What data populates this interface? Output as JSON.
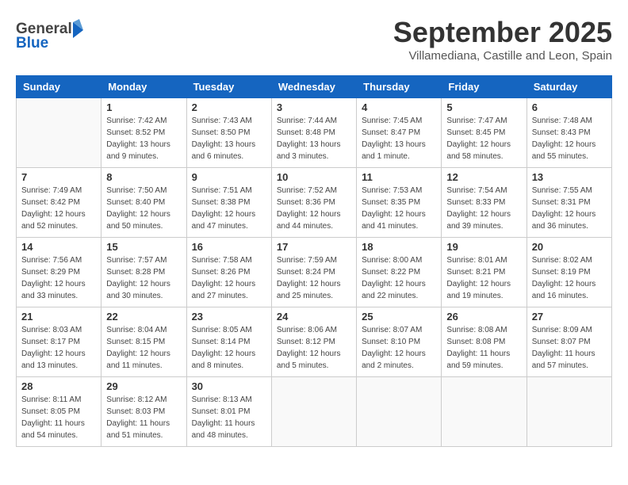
{
  "header": {
    "logo_general": "General",
    "logo_blue": "Blue",
    "month_title": "September 2025",
    "location": "Villamediana, Castille and Leon, Spain"
  },
  "weekdays": [
    "Sunday",
    "Monday",
    "Tuesday",
    "Wednesday",
    "Thursday",
    "Friday",
    "Saturday"
  ],
  "weeks": [
    [
      {
        "day": "",
        "sunrise": "",
        "sunset": "",
        "daylight": ""
      },
      {
        "day": "1",
        "sunrise": "Sunrise: 7:42 AM",
        "sunset": "Sunset: 8:52 PM",
        "daylight": "Daylight: 13 hours and 9 minutes."
      },
      {
        "day": "2",
        "sunrise": "Sunrise: 7:43 AM",
        "sunset": "Sunset: 8:50 PM",
        "daylight": "Daylight: 13 hours and 6 minutes."
      },
      {
        "day": "3",
        "sunrise": "Sunrise: 7:44 AM",
        "sunset": "Sunset: 8:48 PM",
        "daylight": "Daylight: 13 hours and 3 minutes."
      },
      {
        "day": "4",
        "sunrise": "Sunrise: 7:45 AM",
        "sunset": "Sunset: 8:47 PM",
        "daylight": "Daylight: 13 hours and 1 minute."
      },
      {
        "day": "5",
        "sunrise": "Sunrise: 7:47 AM",
        "sunset": "Sunset: 8:45 PM",
        "daylight": "Daylight: 12 hours and 58 minutes."
      },
      {
        "day": "6",
        "sunrise": "Sunrise: 7:48 AM",
        "sunset": "Sunset: 8:43 PM",
        "daylight": "Daylight: 12 hours and 55 minutes."
      }
    ],
    [
      {
        "day": "7",
        "sunrise": "Sunrise: 7:49 AM",
        "sunset": "Sunset: 8:42 PM",
        "daylight": "Daylight: 12 hours and 52 minutes."
      },
      {
        "day": "8",
        "sunrise": "Sunrise: 7:50 AM",
        "sunset": "Sunset: 8:40 PM",
        "daylight": "Daylight: 12 hours and 50 minutes."
      },
      {
        "day": "9",
        "sunrise": "Sunrise: 7:51 AM",
        "sunset": "Sunset: 8:38 PM",
        "daylight": "Daylight: 12 hours and 47 minutes."
      },
      {
        "day": "10",
        "sunrise": "Sunrise: 7:52 AM",
        "sunset": "Sunset: 8:36 PM",
        "daylight": "Daylight: 12 hours and 44 minutes."
      },
      {
        "day": "11",
        "sunrise": "Sunrise: 7:53 AM",
        "sunset": "Sunset: 8:35 PM",
        "daylight": "Daylight: 12 hours and 41 minutes."
      },
      {
        "day": "12",
        "sunrise": "Sunrise: 7:54 AM",
        "sunset": "Sunset: 8:33 PM",
        "daylight": "Daylight: 12 hours and 39 minutes."
      },
      {
        "day": "13",
        "sunrise": "Sunrise: 7:55 AM",
        "sunset": "Sunset: 8:31 PM",
        "daylight": "Daylight: 12 hours and 36 minutes."
      }
    ],
    [
      {
        "day": "14",
        "sunrise": "Sunrise: 7:56 AM",
        "sunset": "Sunset: 8:29 PM",
        "daylight": "Daylight: 12 hours and 33 minutes."
      },
      {
        "day": "15",
        "sunrise": "Sunrise: 7:57 AM",
        "sunset": "Sunset: 8:28 PM",
        "daylight": "Daylight: 12 hours and 30 minutes."
      },
      {
        "day": "16",
        "sunrise": "Sunrise: 7:58 AM",
        "sunset": "Sunset: 8:26 PM",
        "daylight": "Daylight: 12 hours and 27 minutes."
      },
      {
        "day": "17",
        "sunrise": "Sunrise: 7:59 AM",
        "sunset": "Sunset: 8:24 PM",
        "daylight": "Daylight: 12 hours and 25 minutes."
      },
      {
        "day": "18",
        "sunrise": "Sunrise: 8:00 AM",
        "sunset": "Sunset: 8:22 PM",
        "daylight": "Daylight: 12 hours and 22 minutes."
      },
      {
        "day": "19",
        "sunrise": "Sunrise: 8:01 AM",
        "sunset": "Sunset: 8:21 PM",
        "daylight": "Daylight: 12 hours and 19 minutes."
      },
      {
        "day": "20",
        "sunrise": "Sunrise: 8:02 AM",
        "sunset": "Sunset: 8:19 PM",
        "daylight": "Daylight: 12 hours and 16 minutes."
      }
    ],
    [
      {
        "day": "21",
        "sunrise": "Sunrise: 8:03 AM",
        "sunset": "Sunset: 8:17 PM",
        "daylight": "Daylight: 12 hours and 13 minutes."
      },
      {
        "day": "22",
        "sunrise": "Sunrise: 8:04 AM",
        "sunset": "Sunset: 8:15 PM",
        "daylight": "Daylight: 12 hours and 11 minutes."
      },
      {
        "day": "23",
        "sunrise": "Sunrise: 8:05 AM",
        "sunset": "Sunset: 8:14 PM",
        "daylight": "Daylight: 12 hours and 8 minutes."
      },
      {
        "day": "24",
        "sunrise": "Sunrise: 8:06 AM",
        "sunset": "Sunset: 8:12 PM",
        "daylight": "Daylight: 12 hours and 5 minutes."
      },
      {
        "day": "25",
        "sunrise": "Sunrise: 8:07 AM",
        "sunset": "Sunset: 8:10 PM",
        "daylight": "Daylight: 12 hours and 2 minutes."
      },
      {
        "day": "26",
        "sunrise": "Sunrise: 8:08 AM",
        "sunset": "Sunset: 8:08 PM",
        "daylight": "Daylight: 11 hours and 59 minutes."
      },
      {
        "day": "27",
        "sunrise": "Sunrise: 8:09 AM",
        "sunset": "Sunset: 8:07 PM",
        "daylight": "Daylight: 11 hours and 57 minutes."
      }
    ],
    [
      {
        "day": "28",
        "sunrise": "Sunrise: 8:11 AM",
        "sunset": "Sunset: 8:05 PM",
        "daylight": "Daylight: 11 hours and 54 minutes."
      },
      {
        "day": "29",
        "sunrise": "Sunrise: 8:12 AM",
        "sunset": "Sunset: 8:03 PM",
        "daylight": "Daylight: 11 hours and 51 minutes."
      },
      {
        "day": "30",
        "sunrise": "Sunrise: 8:13 AM",
        "sunset": "Sunset: 8:01 PM",
        "daylight": "Daylight: 11 hours and 48 minutes."
      },
      {
        "day": "",
        "sunrise": "",
        "sunset": "",
        "daylight": ""
      },
      {
        "day": "",
        "sunrise": "",
        "sunset": "",
        "daylight": ""
      },
      {
        "day": "",
        "sunrise": "",
        "sunset": "",
        "daylight": ""
      },
      {
        "day": "",
        "sunrise": "",
        "sunset": "",
        "daylight": ""
      }
    ]
  ]
}
